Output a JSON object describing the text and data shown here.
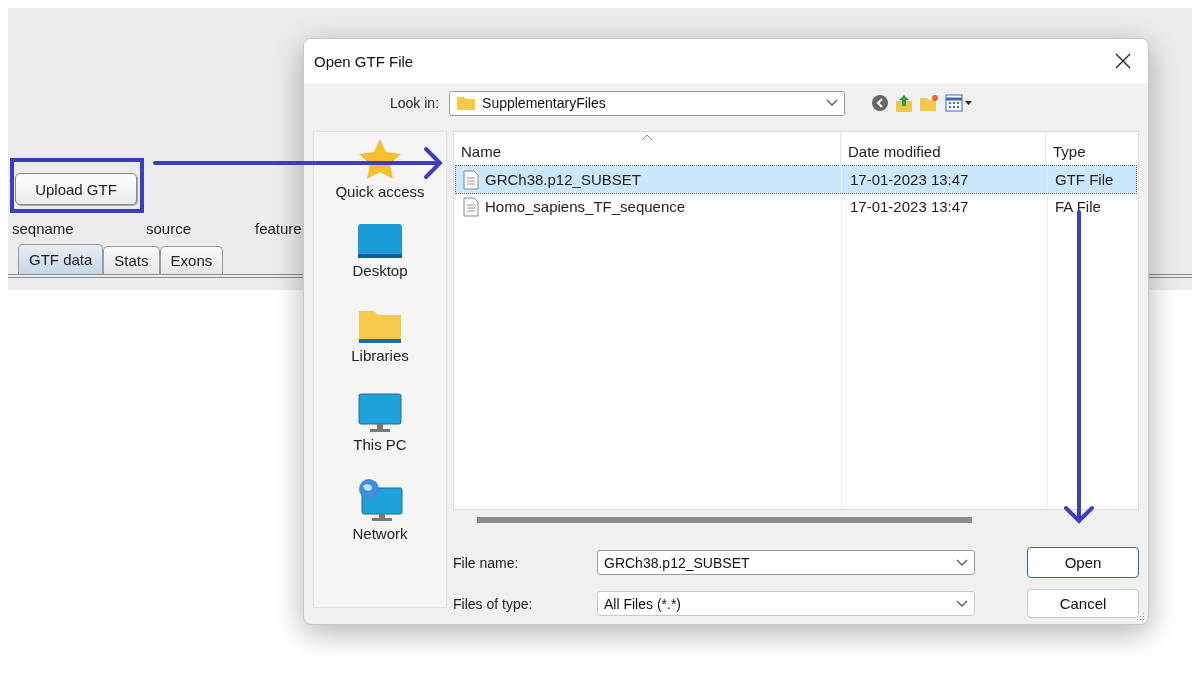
{
  "app": {
    "upload_button": "Upload GTF",
    "columns": [
      "seqname",
      "source",
      "feature"
    ],
    "tabs": [
      {
        "label": "GTF data",
        "selected": true
      },
      {
        "label": "Stats",
        "selected": false
      },
      {
        "label": "Exons",
        "selected": false
      }
    ]
  },
  "dialog": {
    "title": "Open GTF File",
    "look_in": {
      "label": "Look in:",
      "value": "SupplementaryFiles"
    },
    "places": [
      {
        "label": "Quick access"
      },
      {
        "label": "Desktop"
      },
      {
        "label": "Libraries"
      },
      {
        "label": "This PC"
      },
      {
        "label": "Network"
      }
    ],
    "file_list": {
      "columns": [
        "Name",
        "Date modified",
        "Type"
      ],
      "rows": [
        {
          "name": "GRCh38.p12_SUBSET",
          "date": "17-01-2023 13:47",
          "type": "GTF File",
          "selected": true
        },
        {
          "name": "Homo_sapiens_TF_sequence",
          "date": "17-01-2023 13:47",
          "type": "FA File",
          "selected": false
        }
      ]
    },
    "file_name": {
      "label": "File name:",
      "value": "GRCh38.p12_SUBSET"
    },
    "file_type": {
      "label": "Files of type:",
      "value": "All Files (*.*)"
    },
    "buttons": [
      {
        "label": "Open",
        "kind": "default"
      },
      {
        "label": "Cancel",
        "kind": "normal"
      }
    ]
  }
}
